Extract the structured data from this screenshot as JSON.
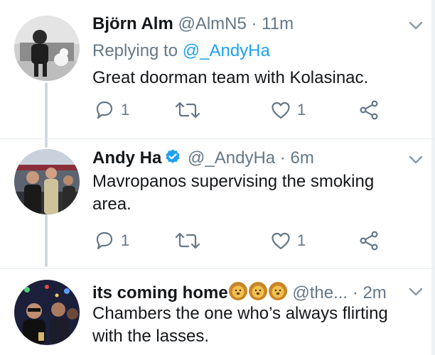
{
  "tweets": [
    {
      "name": "Björn Alm",
      "handle": "@AlmN5",
      "separator": "·",
      "time": "11m",
      "replying_prefix": "Replying to ",
      "replying_to": "@_AndyHa",
      "text": "Great doorman team with Kolasinac.",
      "reply_count": "1",
      "like_count": "1"
    },
    {
      "name": "Andy Ha",
      "verified": true,
      "handle": "@_AndyHa",
      "separator": "·",
      "time": "6m",
      "text_line1": "Mavropanos supervising the smoking",
      "text_line2": "area.",
      "reply_count": "1",
      "like_count": "1"
    },
    {
      "name": "its coming home",
      "name_emojis": [
        "lion-face",
        "lion-face",
        "lion-face"
      ],
      "handle": "@the...",
      "separator": "·",
      "time": "2m",
      "text_line1": "Chambers the one who’s always flirting",
      "text_line2": "with the lasses."
    }
  ],
  "colors": {
    "link": "#1da1f2",
    "muted": "#657786",
    "text": "#14171a",
    "thread_line": "#cfd9de",
    "divider": "#e6ecf0"
  },
  "icons": [
    "reply-icon",
    "retweet-icon",
    "like-icon",
    "share-icon",
    "chevron-down-icon",
    "verified-badge-icon"
  ]
}
